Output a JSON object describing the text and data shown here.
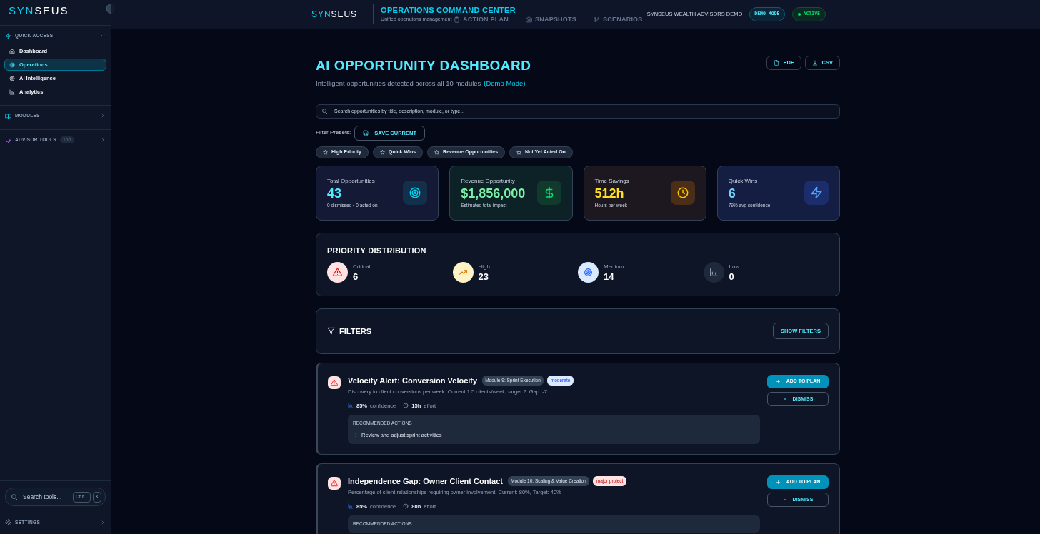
{
  "sidebar": {
    "logo": {
      "first": "SYN",
      "second": "SEUS"
    },
    "sections": [
      {
        "label": "QUICK ACCESS",
        "expanded": true,
        "items": [
          {
            "label": "Dashboard",
            "selected": false
          },
          {
            "label": "Operations",
            "selected": true
          },
          {
            "label": "AI Intelligence",
            "selected": false
          },
          {
            "label": "Analytics",
            "selected": false
          }
        ]
      },
      {
        "label": "MODULES",
        "expanded": false
      },
      {
        "label": "ADVISOR TOOLS",
        "badge": "165",
        "expanded": false
      }
    ],
    "search": {
      "placeholder": "Search tools...",
      "keys": [
        "Ctrl",
        "K"
      ]
    },
    "settings": "SETTINGS"
  },
  "header": {
    "logo": {
      "first": "SYN",
      "second": "SEUS"
    },
    "title": "OPERATIONS COMMAND CENTER",
    "subtitle": "Unified operations management",
    "org": "SYNSEUS WEALTH ADVISORS DEMO",
    "mode_badge": "DEMO MODE",
    "status": "ACTIVE"
  },
  "tabs_behind": [
    "ACTION PLAN",
    "SNAPSHOTS",
    "SCENARIOS"
  ],
  "page": {
    "title": "AI OPPORTUNITY DASHBOARD",
    "subtitle": "Intelligent opportunities detected across all 10 modules",
    "mode": "(Demo Mode)",
    "exports": [
      "PDF",
      "CSV"
    ],
    "search": {
      "placeholder": "Search opportunities by title, description, module, or type..."
    },
    "presets_label": "Filter Presets:",
    "save_button": "SAVE CURRENT",
    "presets": [
      "High Priority",
      "Quick Wins",
      "Revenue Opportunities",
      "Not Yet Acted On"
    ]
  },
  "stats": [
    {
      "label": "Total Opportunities",
      "value": "43",
      "note": "0 dismissed • 0 acted on"
    },
    {
      "label": "Revenue Opportunity",
      "value": "$1,856,000",
      "note": "Estimated total impact"
    },
    {
      "label": "Time Savings",
      "value": "512h",
      "note": "Hours per week"
    },
    {
      "label": "Quick Wins",
      "value": "6",
      "note": "79% avg confidence"
    }
  ],
  "priority_distribution": {
    "title": "PRIORITY DISTRIBUTION",
    "levels": [
      {
        "label": "Critical",
        "count": "6"
      },
      {
        "label": "High",
        "count": "23"
      },
      {
        "label": "Medium",
        "count": "14"
      },
      {
        "label": "Low",
        "count": "0"
      }
    ]
  },
  "filters": {
    "title": "FILTERS",
    "button": "SHOW FILTERS"
  },
  "opportunities": [
    {
      "title": "Velocity Alert: Conversion Velocity",
      "module": "Module 9: Sprint Execution",
      "tag": {
        "text": "moderate",
        "kind": "moderate"
      },
      "description": "Discovery to client conversions per week: Current 1.5 clients/week, target 2. Gap: -7",
      "confidence": "85%",
      "confidence_label": "confidence",
      "effort": "15h",
      "effort_label": "effort",
      "actions_heading": "RECOMMENDED ACTIONS",
      "actions": [
        "Review and adjust sprint activities"
      ],
      "add_button": "ADD TO PLAN",
      "dismiss_button": "DISMISS"
    },
    {
      "title": "Independence Gap: Owner Client Contact",
      "module": "Module 10: Scaling & Value Creation",
      "tag": {
        "text": "major project",
        "kind": "major"
      },
      "description": "Percentage of client relationships requiring owner involvement. Current: 80%, Target: 40%",
      "confidence": "85%",
      "confidence_label": "confidence",
      "effort": "80h",
      "effort_label": "effort",
      "actions_heading": "RECOMMENDED ACTIONS",
      "add_button": "ADD TO PLAN",
      "dismiss_button": "DISMISS"
    }
  ]
}
